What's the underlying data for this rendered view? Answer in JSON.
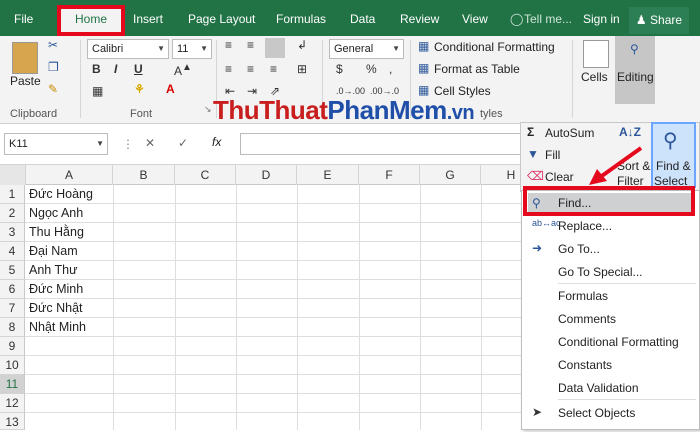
{
  "tabs": [
    "File",
    "Home",
    "Insert",
    "Page Layout",
    "Formulas",
    "Data",
    "Review",
    "View"
  ],
  "tell_me": "Tell me...",
  "sign_in": "Sign in",
  "share": "Share",
  "clipboard": {
    "paste": "Paste",
    "group": "Clipboard"
  },
  "font": {
    "name": "Calibri",
    "size": "11",
    "group": "Font"
  },
  "number": {
    "format": "General"
  },
  "styles": {
    "conditional": "Conditional Formatting",
    "format_table": "Format as Table",
    "cell_styles": "Cell Styles",
    "group_partial": "tyles"
  },
  "cells": {
    "label": "Cells"
  },
  "editing": {
    "label": "Editing"
  },
  "name_box": "K11",
  "fx": "fx",
  "columns": [
    "A",
    "B",
    "C",
    "D",
    "E",
    "F",
    "G",
    "H"
  ],
  "rows": [
    "1",
    "2",
    "3",
    "4",
    "5",
    "6",
    "7",
    "8",
    "9",
    "10",
    "11",
    "12",
    "13"
  ],
  "cells_a": [
    "Đức Hoàng",
    "Ngọc Anh",
    "Thu Hằng",
    "Đại Nam",
    "Anh Thư",
    "Đức Minh",
    "Đức Nhật",
    "Nhật Minh"
  ],
  "watermark": {
    "part1": "ThuThuat",
    "part2": "PhanMem",
    "part3": ".vn"
  },
  "editing_panel": {
    "autosum": "AutoSum",
    "fill": "Fill",
    "clear": "Clear",
    "sort": "Sort &",
    "filter": "Filter",
    "find": "Find &",
    "select": "Select"
  },
  "menu": {
    "items": [
      "Find...",
      "Replace...",
      "Go To...",
      "Go To Special...",
      "Formulas",
      "Comments",
      "Conditional Formatting",
      "Constants",
      "Data Validation",
      "Select Objects"
    ]
  },
  "colors": {
    "accent": "#217346",
    "highlight": "#e5091d"
  }
}
